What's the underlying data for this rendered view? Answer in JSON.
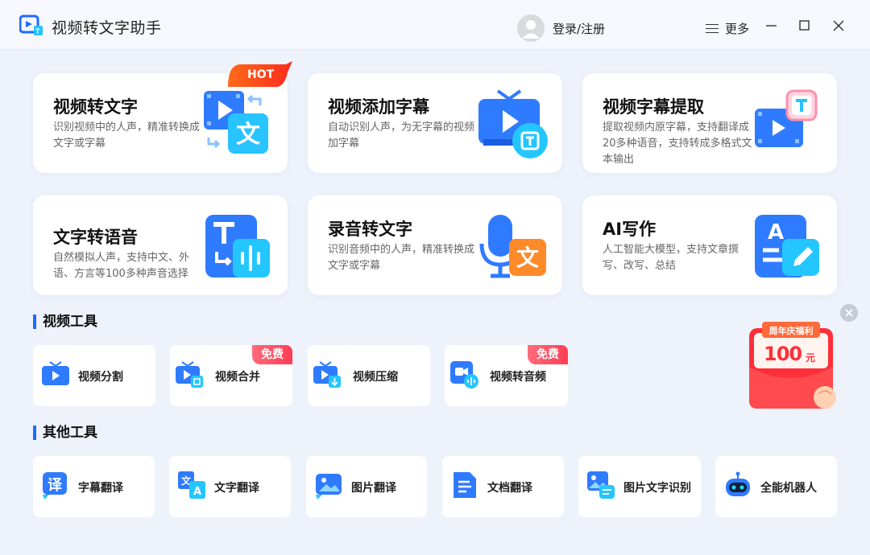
{
  "app": {
    "title": "视频转文字助手",
    "login_label": "登录/注册",
    "more_label": "更多"
  },
  "feature_cards": [
    {
      "title": "视频转文字",
      "desc": "识别视频中的人声，精准转换成文字或字幕",
      "icon": "video-to-text-icon",
      "badge": "HOT"
    },
    {
      "title": "视频添加字幕",
      "desc": "自动识别人声，为无字幕的视频加字幕",
      "icon": "tv-subtitle-icon"
    },
    {
      "title": "视频字幕提取",
      "desc": "提取视频内原字幕，支持翻译成20多种语音，支持转成多格式文本输出",
      "icon": "subtitle-extract-icon"
    },
    {
      "title": "文字转语音",
      "desc": "自然模拟人声，支持中文、外语、方言等100多种声音选择",
      "icon": "text-to-speech-icon"
    },
    {
      "title": "录音转文字",
      "desc": "识别音频中的人声，精准转换成文字或字幕",
      "icon": "mic-to-text-icon"
    },
    {
      "title": "AI写作",
      "desc": "人工智能大模型，支持文章撰写、改写、总结",
      "icon": "ai-writing-icon"
    }
  ],
  "sections": {
    "video_tools": "视频工具",
    "other_tools": "其他工具"
  },
  "video_tools": [
    {
      "label": "视频分割",
      "icon": "video-split-icon"
    },
    {
      "label": "视频合并",
      "icon": "video-merge-icon",
      "badge": "免费"
    },
    {
      "label": "视频压缩",
      "icon": "video-compress-icon"
    },
    {
      "label": "视频转音频",
      "icon": "video-to-audio-icon",
      "badge": "免费"
    }
  ],
  "other_tools": [
    {
      "label": "字幕翻译",
      "icon": "subtitle-translate-icon"
    },
    {
      "label": "文字翻译",
      "icon": "text-translate-icon"
    },
    {
      "label": "图片翻译",
      "icon": "image-translate-icon"
    },
    {
      "label": "文档翻译",
      "icon": "document-translate-icon"
    },
    {
      "label": "图片文字识别",
      "icon": "image-ocr-icon"
    },
    {
      "label": "全能机器人",
      "icon": "robot-icon"
    }
  ],
  "promo": {
    "banner_text": "周年庆福利",
    "amount": "100",
    "unit": "元"
  },
  "colors": {
    "accent": "#1f6bff",
    "background": "#eef2fb",
    "hot": "#ff4a1c",
    "free": "#ff3d55",
    "promo_red": "#ff2f3a"
  }
}
